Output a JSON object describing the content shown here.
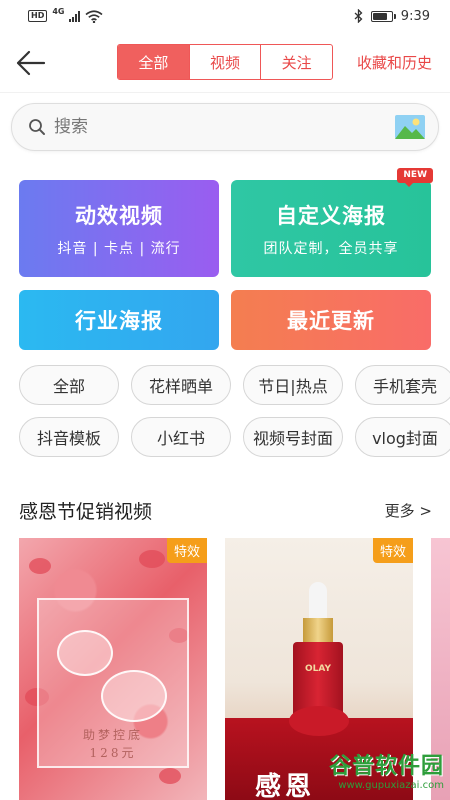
{
  "status_bar": {
    "hd": "HD",
    "network": "4G",
    "time": "9:39"
  },
  "header": {
    "back_icon": "arrow-left-icon",
    "tabs": [
      {
        "label": "全部",
        "active": true
      },
      {
        "label": "视频",
        "active": false
      },
      {
        "label": "关注",
        "active": false
      }
    ],
    "history_label": "收藏和历史",
    "accent_color": "#f0605e"
  },
  "search": {
    "placeholder": "搜索",
    "search_icon": "search-icon",
    "image_icon": "image-icon"
  },
  "feature_cards": {
    "video": {
      "title": "动效视频",
      "subtitle": "抖音 | 卡点 | 流行"
    },
    "poster": {
      "title": "自定义海报",
      "subtitle": "团队定制，全员共享",
      "badge": "NEW"
    },
    "industry": {
      "title": "行业海报"
    },
    "recent": {
      "title": "最近更新"
    }
  },
  "tags": {
    "row1": [
      "全部",
      "花样晒单",
      "节日|热点",
      "手机套壳"
    ],
    "row2": [
      "抖音模板",
      "小红书",
      "视频号封面",
      "vlog封面"
    ]
  },
  "section": {
    "title": "感恩节促销视频",
    "more_label": "更多 >",
    "items": [
      {
        "badge": "特效",
        "line1": "助梦控底",
        "line2": "128元"
      },
      {
        "badge": "特效",
        "brand": "OLAY",
        "overlay_text": "感恩"
      }
    ]
  },
  "watermark": {
    "name": "谷普软件园",
    "url": "www.gupuxiazai.com"
  }
}
